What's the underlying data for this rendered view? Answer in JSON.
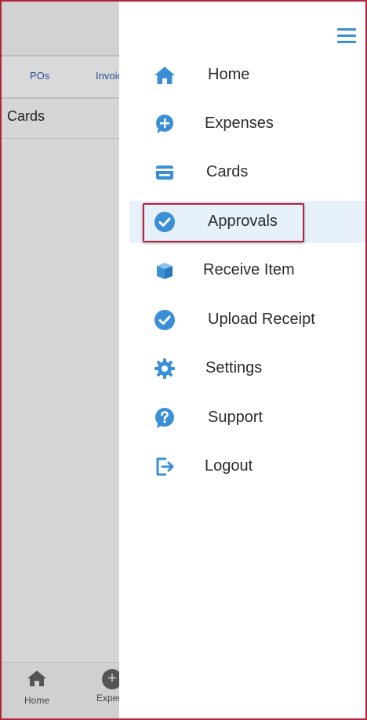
{
  "background": {
    "tabs": [
      {
        "label": "POs"
      },
      {
        "label": "Invoic"
      }
    ],
    "cards_label": "Cards",
    "bottom_nav": [
      {
        "label": "Home"
      },
      {
        "label": "Expens"
      }
    ]
  },
  "drawer": {
    "menu_icon": "hamburger-icon",
    "items": [
      {
        "label": "Home",
        "icon": "home-icon"
      },
      {
        "label": "Expenses",
        "icon": "add-expense-icon"
      },
      {
        "label": "Cards",
        "icon": "card-icon"
      },
      {
        "label": "Approvals",
        "icon": "check-circle-icon"
      },
      {
        "label": "Receive Item",
        "icon": "box-icon"
      },
      {
        "label": "Upload Receipt",
        "icon": "check-circle-icon"
      },
      {
        "label": "Settings",
        "icon": "gear-icon"
      },
      {
        "label": "Support",
        "icon": "help-icon"
      },
      {
        "label": "Logout",
        "icon": "logout-icon"
      }
    ]
  },
  "colors": {
    "accent": "#3a8fd6",
    "highlight_border": "#b5213f",
    "active_bg": "#e6f1fa"
  }
}
